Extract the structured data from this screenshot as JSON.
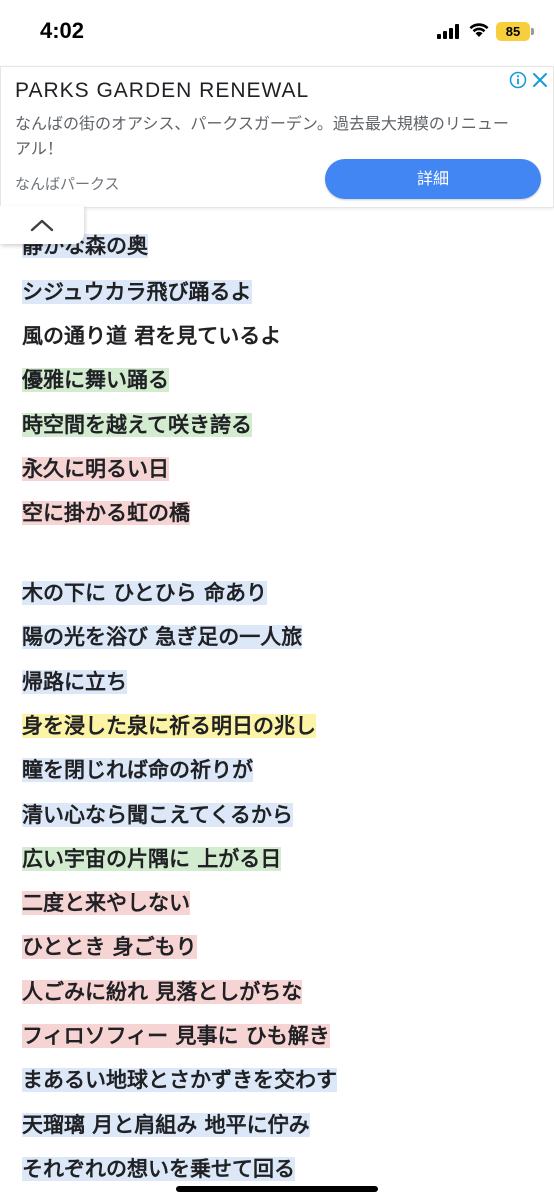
{
  "status_bar": {
    "time": "4:02",
    "battery": "85"
  },
  "ad": {
    "title": "PARKS GARDEN RENEWAL",
    "description": "なんばの街のオアシス、パークスガーデン。過去最大規模のリニューアル！",
    "source": "なんばパークス",
    "button_label": "詳細"
  },
  "lyrics": [
    "静かな森の奥",
    "シジュウカラ飛び踊るよ",
    "風の通り道 君を見ているよ",
    "優雅に舞い踊る",
    "時空間を越えて咲き誇る",
    "永久に明るい日",
    "空に掛かる虹の橋",
    "木の下に ひとひら 命あり",
    "陽の光を浴び 急ぎ足の一人旅",
    "帰路に立ち",
    "身を浸した泉に祈る明日の兆し",
    "瞳を閉じれば命の祈りが",
    "清い心なら聞こえてくるから",
    "広い宇宙の片隅に 上がる日",
    "二度と来やしない",
    "ひととき 身ごもり",
    "人ごみに紛れ 見落としがちな",
    "フィロソフィー 見事に ひも解き",
    "まあるい地球とさかずきを交わす",
    "天瑠璃 月と肩組み 地平に佇み",
    "それぞれの想いを乗せて回る"
  ],
  "colors": {
    "highlight_blue": "#dce8f8",
    "highlight_yellow": "#fbf3a5",
    "highlight_green": "#d3ecd0",
    "highlight_pink": "#f6d4d4",
    "ad_button": "#4286f4",
    "battery": "#f7cf3c"
  }
}
